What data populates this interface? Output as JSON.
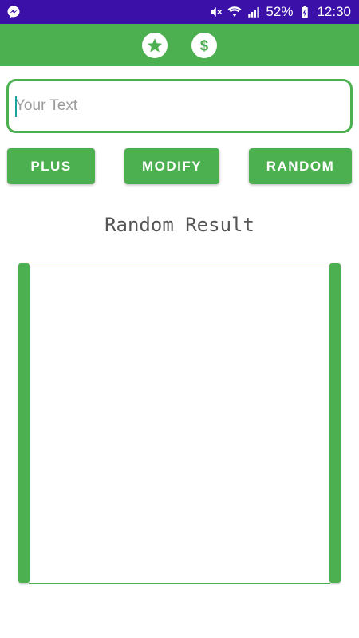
{
  "status_bar": {
    "battery_percent": "52%",
    "time": "12:30",
    "icons": [
      "messenger-icon",
      "mute-icon",
      "wifi-icon",
      "signal-icon",
      "battery-icon"
    ]
  },
  "app_bar": {
    "icons": [
      "star-icon",
      "dollar-icon"
    ],
    "color": "#4caf50"
  },
  "input": {
    "placeholder": "Your Text",
    "value": ""
  },
  "buttons": {
    "plus": "PLUS",
    "modify": "MODIFY",
    "random": "RANDOM"
  },
  "result": {
    "title": "Random Result",
    "content": ""
  },
  "colors": {
    "status_bar": "#3a10a8",
    "accent": "#4caf50",
    "caret": "#19a59a"
  }
}
